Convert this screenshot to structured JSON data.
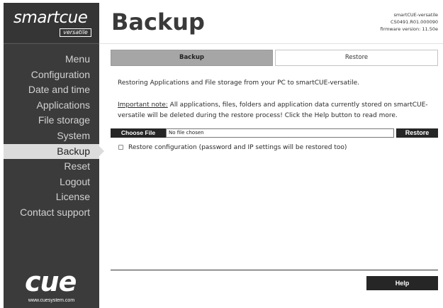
{
  "brand": {
    "logo_light": "smart",
    "logo_bold": "cue",
    "logo_sub": "versatile",
    "footer_logo": "cue",
    "footer_url": "www.cuesystem.com"
  },
  "sidebar": {
    "items": [
      {
        "label": "Menu"
      },
      {
        "label": "Configuration"
      },
      {
        "label": "Date and time"
      },
      {
        "label": "Applications"
      },
      {
        "label": "File storage"
      },
      {
        "label": "System"
      },
      {
        "label": "Backup",
        "active": true
      },
      {
        "label": "Reset"
      },
      {
        "label": "Logout"
      },
      {
        "label": "License"
      },
      {
        "label": "Contact support"
      }
    ]
  },
  "header": {
    "title": "Backup",
    "device_name": "smartCUE-versatile",
    "device_id": "CS0491.R01.000090",
    "firmware": "firmware version: 11.50e"
  },
  "tabs": {
    "backup": "Backup",
    "restore": "Restore"
  },
  "content": {
    "intro": "Restoring Applications and File storage from your PC to smartCUE-versatile.",
    "note_label": "Important note:",
    "note_text": " All applications, files, folders and application data currently stored on smartCUE-versatile will be deleted during the restore process! Click the Help button to read more.",
    "choose_file_label": "Choose File",
    "file_name": "No file chosen",
    "restore_label": "Restore",
    "restore_config_label": "Restore configuration (password and IP settings will be restored too)",
    "restore_config_checked": false,
    "help_label": "Help"
  },
  "colors": {
    "sidebar_bg": "#3b3b3b",
    "active_item_bg": "#dcdcdc",
    "active_tab_bg": "#a6a6a6",
    "button_bg": "#262626"
  }
}
